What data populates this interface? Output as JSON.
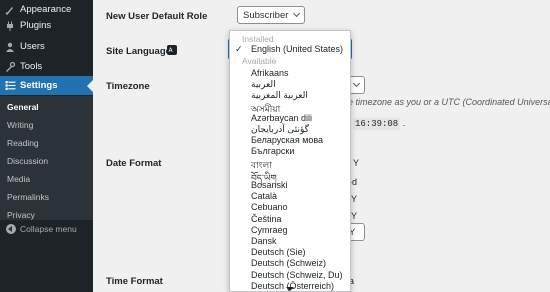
{
  "sidebar": {
    "items": [
      {
        "label": "Appearance",
        "icon": "appearance-icon"
      },
      {
        "label": "Plugins",
        "icon": "plugins-icon"
      },
      {
        "label": "Users",
        "icon": "users-icon"
      },
      {
        "label": "Tools",
        "icon": "tools-icon"
      },
      {
        "label": "Settings",
        "icon": "settings-icon"
      }
    ],
    "submenu": [
      "General",
      "Writing",
      "Reading",
      "Discussion",
      "Media",
      "Permalinks",
      "Privacy"
    ],
    "collapse_label": "Collapse menu"
  },
  "form": {
    "new_user_role_label": "New User Default Role",
    "new_user_role_value": "Subscriber",
    "site_language_label": "Site Language",
    "timezone_label": "Timezone",
    "timezone_description": "he timezone as you or a UTC (Coordinated Universal T",
    "time_value": "16:39:08",
    "date_format_label": "Date Format",
    "time_format_label": "Time Format",
    "background_fragments": [
      ".",
      "Y",
      "-d",
      "Y",
      "Y",
      "Y",
      "a"
    ]
  },
  "dropdown": {
    "installed_label": "Installed",
    "selected": "English (United States)",
    "available_label": "Available",
    "languages": [
      "Afrikaans",
      "العربية",
      "العربية المغربية",
      "অসমীয়া",
      "Azərbaycan dili",
      "گؤنئی آذربایجان",
      "Беларуская мова",
      "Български",
      "বাংলা",
      "བོད་ཡིག",
      "Bosanski",
      "Català",
      "Cebuano",
      "Čeština",
      "Cymraeg",
      "Dansk",
      "Deutsch (Sie)",
      "Deutsch (Schweiz)",
      "Deutsch (Schweiz, Du)",
      "Deutsch (Österreich)"
    ]
  }
}
